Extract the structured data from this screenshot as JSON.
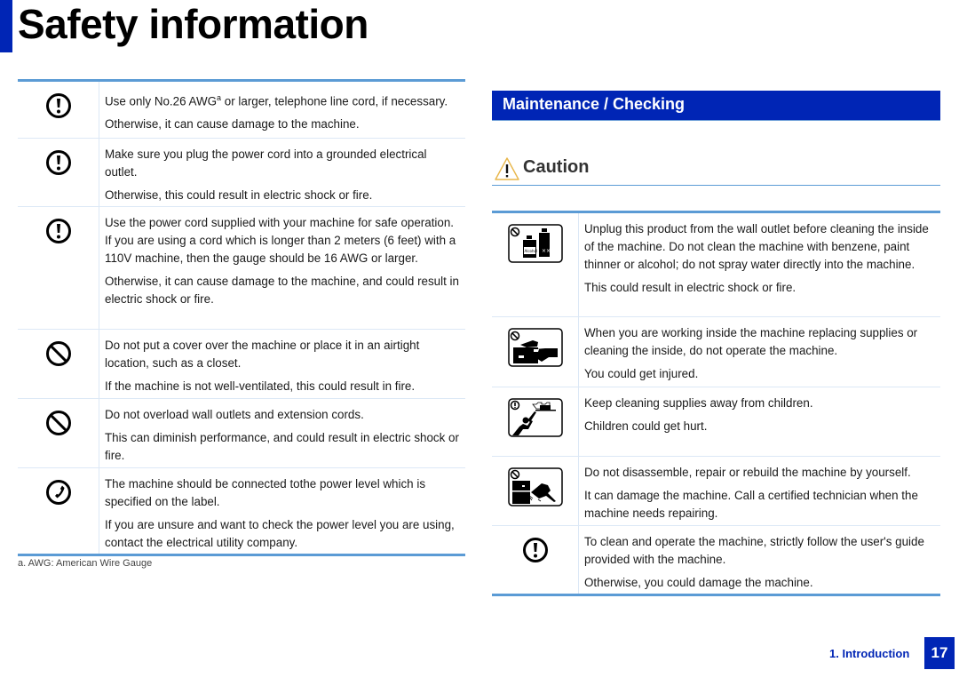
{
  "page": {
    "title": "Safety information",
    "footer": {
      "section_label": "1. Introduction",
      "page_number": "17"
    },
    "brand_color": "#0025b5",
    "rule_color": "#5b9bd5"
  },
  "left_table": {
    "rows": [
      {
        "icon": "mandatory-icon",
        "lines": [
          "Use only No.26 AWG",
          "Otherwise, it can cause damage to the machine."
        ],
        "sup": "a",
        "first_line_suffix": " or larger, telephone line cord, if necessary."
      },
      {
        "icon": "mandatory-icon",
        "lines": [
          "Make sure you plug the power cord into a grounded electrical outlet.",
          "Otherwise, this could result in electric shock or fire."
        ]
      },
      {
        "icon": "mandatory-icon",
        "lines": [
          "Use the power cord supplied with your machine for safe operation. If you are using a cord which is longer than 2 meters (6 feet) with a 110V machine, then the gauge should be 16 AWG or larger.",
          "Otherwise, it can cause damage to the machine, and could result in electric shock or fire."
        ]
      },
      {
        "icon": "prohibited-icon",
        "lines": [
          "Do not put a cover over the machine or place it in an airtight location, such as a closet.",
          "If the machine is not well-ventilated, this could result in fire."
        ]
      },
      {
        "icon": "prohibited-icon",
        "lines": [
          "Do not overload wall outlets and extension cords.",
          "This can diminish performance, and could result in electric shock or fire."
        ]
      },
      {
        "icon": "phone-contact-icon",
        "lines": [
          "The machine should be connected tothe power level which is specified on the label.",
          "If you are unsure and want to check the power level you are using, contact the electrical utility company."
        ]
      }
    ],
    "footnote": "a.  AWG: American Wire Gauge"
  },
  "right_section": {
    "heading": "Maintenance / Checking",
    "caution_label": "Caution",
    "rows": [
      {
        "icon": "no-chemical-cleaners-icon",
        "bottle_label": "Alcohol",
        "lines": [
          "Unplug this product from the wall outlet before cleaning the inside of the machine. Do not clean the machine with benzene, paint thinner or alcohol; do not spray water directly into the machine.",
          "This could result in electric shock or fire."
        ]
      },
      {
        "icon": "no-operation-while-servicing-icon",
        "lines": [
          "When you are working inside the machine replacing supplies or cleaning the inside, do not operate the machine.",
          "You could get injured."
        ]
      },
      {
        "icon": "keep-from-children-icon",
        "lines": [
          "Keep cleaning supplies away from children.",
          "Children could get hurt."
        ]
      },
      {
        "icon": "no-disassembly-icon",
        "lines": [
          "Do not disassemble, repair or rebuild the machine by yourself.",
          "It can damage the machine. Call a certified technician when the machine needs repairing."
        ]
      },
      {
        "icon": "mandatory-icon",
        "lines": [
          "To clean and operate the machine, strictly follow the user's guide provided with the machine.",
          "Otherwise, you could damage the machine."
        ]
      }
    ]
  }
}
